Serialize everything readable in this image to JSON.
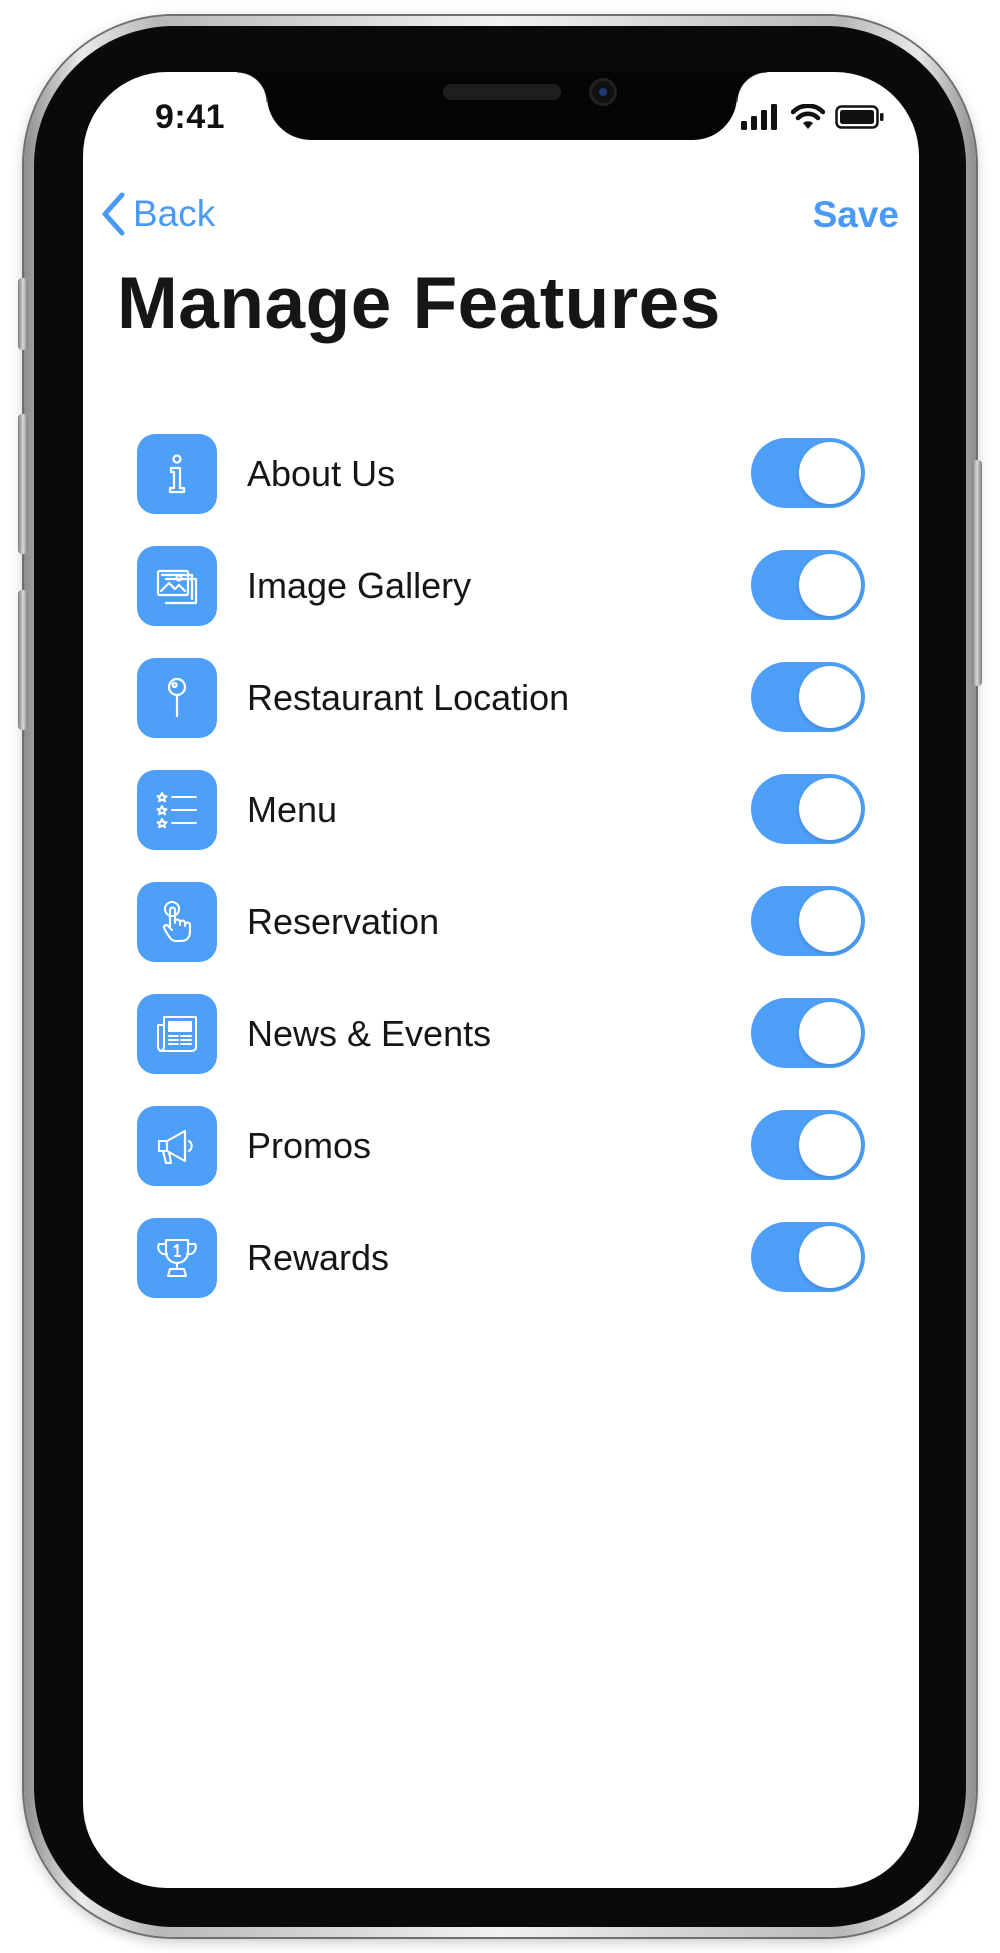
{
  "status_bar": {
    "time": "9:41"
  },
  "nav": {
    "back_label": "Back",
    "save_label": "Save"
  },
  "page": {
    "title": "Manage Features"
  },
  "accent_color": "#4e9ff7",
  "features": [
    {
      "label": "About Us",
      "icon": "info-icon",
      "enabled": true
    },
    {
      "label": "Image Gallery",
      "icon": "image-gallery-icon",
      "enabled": true
    },
    {
      "label": "Restaurant Location",
      "icon": "location-pin-icon",
      "enabled": true
    },
    {
      "label": "Menu",
      "icon": "menu-list-icon",
      "enabled": true
    },
    {
      "label": "Reservation",
      "icon": "tap-hand-icon",
      "enabled": true
    },
    {
      "label": "News & Events",
      "icon": "newspaper-icon",
      "enabled": true
    },
    {
      "label": "Promos",
      "icon": "megaphone-icon",
      "enabled": true
    },
    {
      "label": "Rewards",
      "icon": "trophy-icon",
      "enabled": true
    }
  ]
}
